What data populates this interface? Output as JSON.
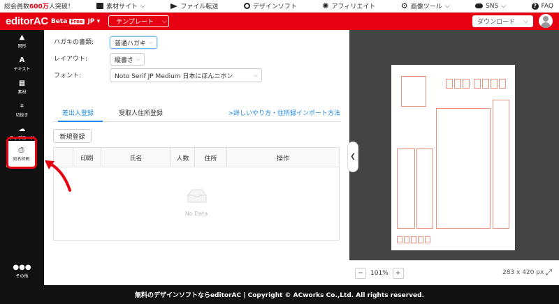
{
  "topbar": {
    "members_prefix": "総会員数",
    "members_count": "600万",
    "members_suffix": "人突破！",
    "nav": [
      {
        "label": "素材サイト",
        "icon": "image-icon"
      },
      {
        "label": "ファイル転送",
        "icon": "paper-plane-icon"
      },
      {
        "label": "デザインソフト",
        "icon": "palette-icon"
      },
      {
        "label": "アフィリエイト",
        "icon": "star-icon"
      },
      {
        "label": "画像ツール",
        "icon": "gear-icon"
      },
      {
        "label": "SNS",
        "icon": "cloud-icon"
      },
      {
        "label": "FAQ",
        "icon": "question-icon"
      }
    ]
  },
  "header": {
    "logo": "editorAC",
    "beta": "Beta",
    "free": "Free",
    "lang": "JP",
    "template_label": "テンプレート",
    "download_label": "ダウンロード"
  },
  "sidebar": {
    "items": [
      {
        "label": "図形"
      },
      {
        "label": "テキスト"
      },
      {
        "label": "素材"
      },
      {
        "label": "切抜き"
      },
      {
        "label": "アップロード"
      },
      {
        "label": "宛名印刷"
      },
      {
        "label": "その他"
      }
    ]
  },
  "form": {
    "card_type_label": "ハガキの書類:",
    "card_type_value": "普通ハガキ",
    "layout_label": "レイアウト:",
    "layout_value": "縦書き",
    "font_label": "フォント:",
    "font_value": "Noto Serif JP Medium 日本にほんニホン"
  },
  "tabs": {
    "sender": "差出人登録",
    "recipient": "受取人住所登録",
    "import_link": ">詳しいやり方・住所録インポート方法"
  },
  "new_button": "新規登録",
  "table": {
    "headers": [
      "",
      "印刷",
      "氏名",
      "人数",
      "住所",
      "操作"
    ],
    "empty": "No Data"
  },
  "zoom": {
    "out": "−",
    "value": "101%",
    "in": "+",
    "size": "283 x 420 px"
  },
  "footer": {
    "text": "無料のデザインソフトならeditorAC | Copyright © ACworks Co.,Ltd. All rights reserved."
  },
  "colors": {
    "brand_red": "#e60012",
    "link_blue": "#1e88e5",
    "sidebar_bg": "#111111",
    "preview_bg": "#444444",
    "card_line": "#e8907a"
  }
}
